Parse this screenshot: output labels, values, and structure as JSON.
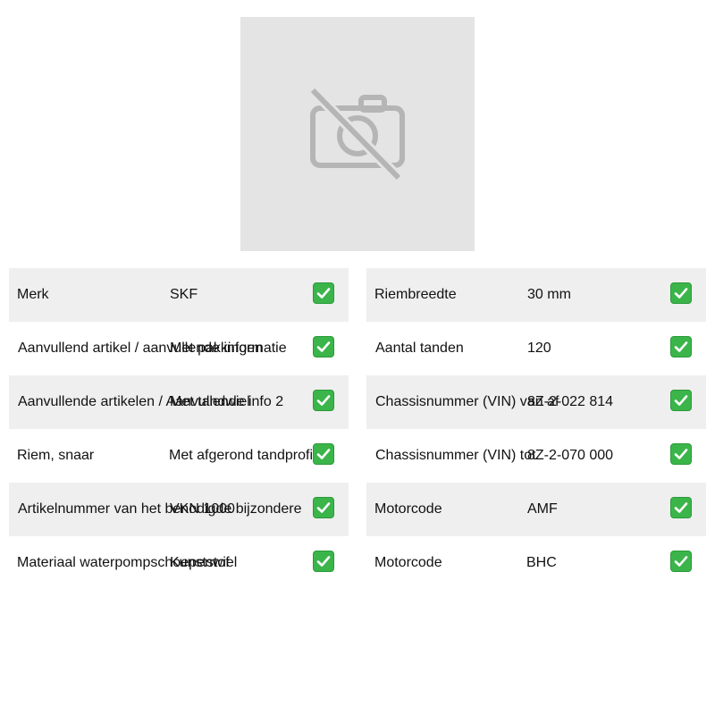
{
  "image": {
    "placeholder_icon": "camera-off-icon"
  },
  "colors": {
    "check": "#3bb54a",
    "row_shade": "#efefef",
    "placeholder_bg": "#e4e4e4"
  },
  "left_table": [
    {
      "label": "Merk",
      "value": "SKF",
      "icon": "check-icon"
    },
    {
      "label": "Aanvullend artikel / aanvullende informatie",
      "value": "Met pakkingen",
      "icon": "check-icon"
    },
    {
      "label": "Aanvullende artikelen / Aanvullende info 2",
      "value": "Met tandwiel",
      "icon": "check-icon"
    },
    {
      "label": "Riem, snaar",
      "value": "Met afgerond tandprofiel",
      "icon": "check-icon"
    },
    {
      "label": "Artikelnummer van het benodigde bijzondere",
      "value": "VKN 1000",
      "icon": "check-icon"
    },
    {
      "label": "Materiaal waterpompschoepenwiel",
      "value": "Kunststof",
      "icon": "check-icon"
    }
  ],
  "right_table": [
    {
      "label": "Riembreedte",
      "value": "30 mm",
      "icon": "check-icon"
    },
    {
      "label": "Aantal tanden",
      "value": "120",
      "icon": "check-icon"
    },
    {
      "label": "Chassisnummer (VIN) van af",
      "value": "8Z-2-022 814",
      "icon": "check-icon"
    },
    {
      "label": "Chassisnummer (VIN) tot",
      "value": "8Z-2-070 000",
      "icon": "check-icon"
    },
    {
      "label": "Motorcode",
      "value": "AMF",
      "icon": "check-icon"
    },
    {
      "label": "Motorcode",
      "value": "BHC",
      "icon": "check-icon"
    }
  ]
}
